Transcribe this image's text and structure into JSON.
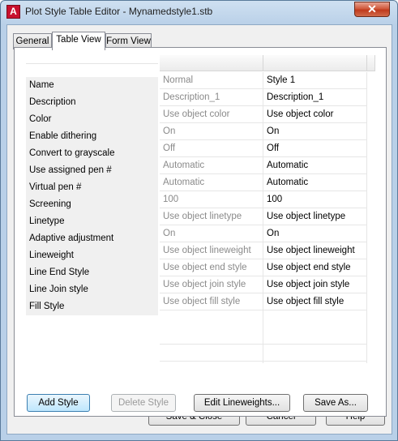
{
  "window": {
    "title": "Plot Style Table Editor - Mynamedstyle1.stb",
    "app_icon_letter": "A",
    "close_glyph": "✕"
  },
  "tabs": [
    {
      "label": "General",
      "active": false
    },
    {
      "label": "Table View",
      "active": true
    },
    {
      "label": "Form View",
      "active": false
    }
  ],
  "table": {
    "rows": [
      {
        "label": "Name",
        "default": "Normal",
        "style1": "Style 1"
      },
      {
        "label": "Description",
        "default": "Description_1",
        "style1": "Description_1"
      },
      {
        "label": "Color",
        "default": "Use object color",
        "style1": "Use object color"
      },
      {
        "label": "Enable dithering",
        "default": "On",
        "style1": "On"
      },
      {
        "label": "Convert to grayscale",
        "default": "Off",
        "style1": "Off"
      },
      {
        "label": "Use assigned pen #",
        "default": "Automatic",
        "style1": "Automatic"
      },
      {
        "label": "Virtual pen #",
        "default": "Automatic",
        "style1": "Automatic"
      },
      {
        "label": "Screening",
        "default": "100",
        "style1": "100"
      },
      {
        "label": "Linetype",
        "default": "Use object linetype",
        "style1": "Use object linetype"
      },
      {
        "label": "Adaptive adjustment",
        "default": "On",
        "style1": "On"
      },
      {
        "label": "Lineweight",
        "default": "Use object lineweight",
        "style1": "Use object lineweight"
      },
      {
        "label": "Line End Style",
        "default": "Use object end style",
        "style1": "Use object end style"
      },
      {
        "label": "Line Join style",
        "default": "Use object join style",
        "style1": "Use object join style"
      },
      {
        "label": "Fill Style",
        "default": "Use object fill style",
        "style1": "Use object fill style"
      }
    ]
  },
  "tab_buttons": {
    "add_style": "Add Style",
    "delete_style": "Delete Style",
    "edit_lineweights": "Edit Lineweights...",
    "save_as": "Save As..."
  },
  "dialog_buttons": {
    "save_close": "Save & Close",
    "cancel": "Cancel",
    "help": "Help"
  },
  "colors": {
    "app_icon": "#c8102e",
    "close_button": "#c03a1c",
    "dim_text": "#8a8a8a"
  }
}
